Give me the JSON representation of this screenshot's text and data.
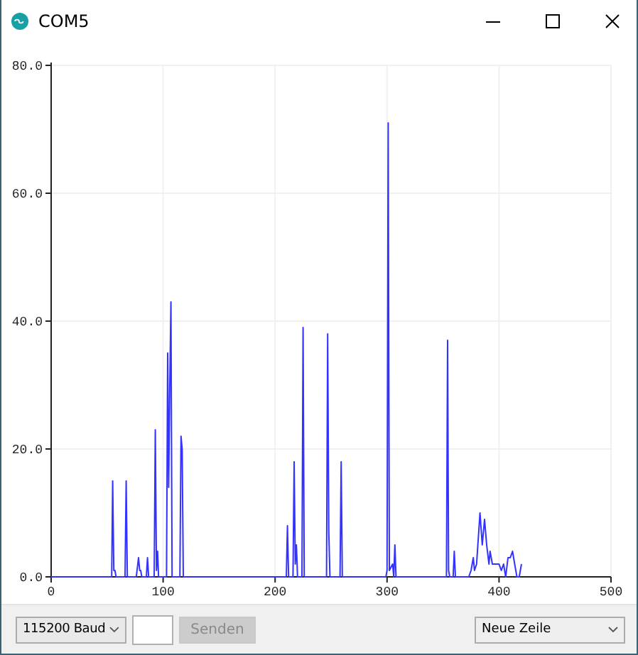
{
  "window": {
    "title": "COM5"
  },
  "plot": {
    "chart_data": {
      "type": "line",
      "x": [
        0,
        54,
        55,
        56,
        57,
        58,
        66,
        67,
        68,
        76,
        78,
        79,
        80,
        81,
        85,
        86,
        87,
        92,
        93,
        94,
        95,
        96,
        97,
        103,
        104,
        105,
        106,
        107,
        108,
        115,
        116,
        117,
        118,
        210,
        211,
        212,
        216,
        217,
        218,
        219,
        220,
        224,
        225,
        226,
        246,
        247,
        248,
        249,
        250,
        258,
        259,
        260,
        299,
        300,
        301,
        302,
        305,
        306,
        307,
        308,
        309,
        353,
        354,
        355,
        356,
        359,
        360,
        361,
        373,
        375,
        377,
        378,
        380,
        383,
        385,
        387,
        389,
        391,
        392,
        394,
        396,
        398,
        400,
        402,
        404,
        406,
        408,
        410,
        412,
        414,
        416,
        418,
        420
      ],
      "series": [
        {
          "color": "#3333ff",
          "values": [
            0,
            0,
            15,
            1,
            1,
            0,
            0,
            15,
            0,
            0,
            3,
            1,
            1,
            0,
            0,
            3,
            0,
            0,
            23,
            1,
            4,
            0,
            0,
            0,
            35,
            14,
            30,
            43,
            0,
            0,
            22,
            20,
            0,
            0,
            8,
            0,
            0,
            18,
            2,
            5,
            0,
            0,
            39,
            0,
            0,
            38,
            7,
            0,
            0,
            0,
            18,
            0,
            0,
            1,
            71,
            1,
            2,
            0,
            5,
            0,
            0,
            0,
            37,
            1,
            0,
            0,
            4,
            0,
            0,
            1,
            3,
            1,
            2,
            10,
            5,
            9,
            5,
            2,
            4,
            2,
            2,
            2,
            2,
            1,
            2,
            0,
            3,
            3,
            4,
            2,
            0,
            0,
            2
          ]
        }
      ],
      "grid": true,
      "xlim": [
        0,
        500
      ],
      "ylim": [
        0,
        80
      ],
      "xticks": [
        0,
        100,
        200,
        300,
        400,
        500
      ],
      "yticks": [
        {
          "value": 0,
          "label": "0.0"
        },
        {
          "value": 20,
          "label": "20.0"
        },
        {
          "value": 40,
          "label": "40.0"
        },
        {
          "value": 60,
          "label": "60.0"
        },
        {
          "value": 80,
          "label": "80.0"
        }
      ]
    }
  },
  "bottom_bar": {
    "baud_select": "115200 Baud",
    "send_button": {
      "label": "Senden",
      "disabled": true
    },
    "line_ending_select": "Neue Zeile"
  }
}
